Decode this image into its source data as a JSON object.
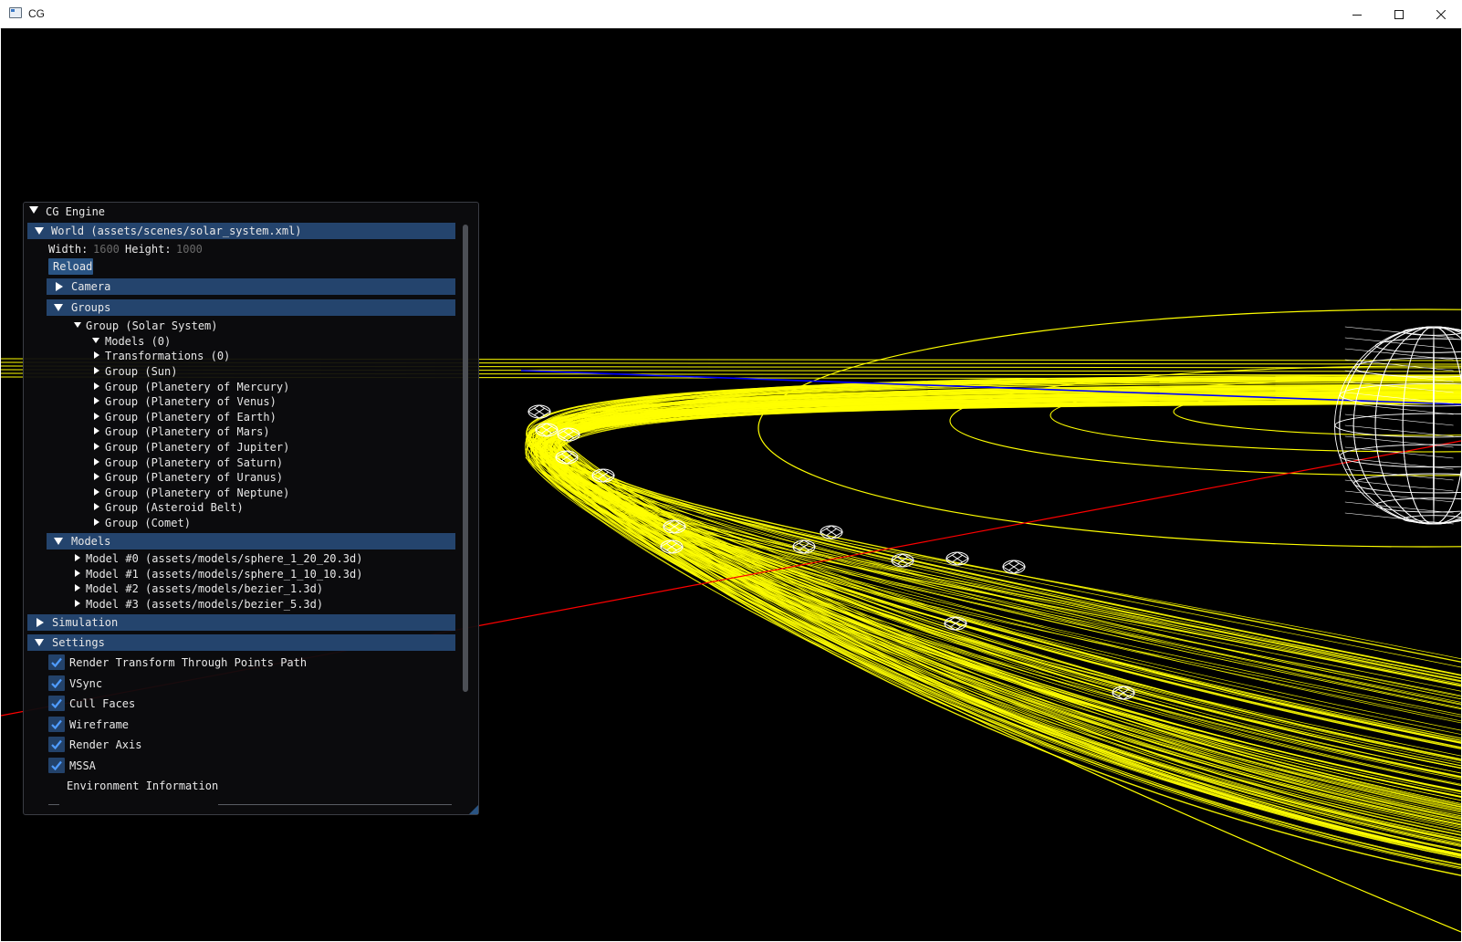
{
  "window": {
    "title": "CG"
  },
  "panel": {
    "title": "CG Engine",
    "world": {
      "header": "World (assets/scenes/solar_system.xml)",
      "width_label": "Width:",
      "width_value": "1600",
      "height_label": "Height:",
      "height_value": "1000",
      "reload_label": "Reload"
    },
    "camera": {
      "label": "Camera"
    },
    "groups": {
      "label": "Groups",
      "root": "Group (Solar System)",
      "models": "Models (0)",
      "transformations": "Transformations (0)",
      "children": [
        "Group (Sun)",
        "Group (Planetery of Mercury)",
        "Group (Planetery of Venus)",
        "Group (Planetery of Earth)",
        "Group (Planetery of Mars)",
        "Group (Planetery of Jupiter)",
        "Group (Planetery of Saturn)",
        "Group (Planetery of Uranus)",
        "Group (Planetery of Neptune)",
        "Group (Asteroid Belt)",
        "Group (Comet)"
      ]
    },
    "models": {
      "label": "Models",
      "items": [
        "Model #0 (assets/models/sphere_1_20_20.3d)",
        "Model #1 (assets/models/sphere_1_10_10.3d)",
        "Model #2 (assets/models/bezier_1.3d)",
        "Model #3 (assets/models/bezier_5.3d)"
      ]
    },
    "simulation": {
      "label": "Simulation"
    },
    "settings": {
      "label": "Settings",
      "options": [
        {
          "label": "Render Transform Through Points Path",
          "checked": true
        },
        {
          "label": "VSync",
          "checked": true
        },
        {
          "label": "Cull Faces",
          "checked": true
        },
        {
          "label": "Wireframe",
          "checked": true
        },
        {
          "label": "Render Axis",
          "checked": true
        },
        {
          "label": "MSSA",
          "checked": true
        }
      ]
    },
    "environment": {
      "label": "Environment Information"
    }
  },
  "colors": {
    "background": "#000000",
    "orbit": "#ffff00",
    "axis_x": "#ff0000",
    "axis_z": "#0000ff",
    "wireframe": "#ffffff",
    "header": "#24446d",
    "checkbox": "#23426a",
    "checkmark": "#4f9cff"
  }
}
